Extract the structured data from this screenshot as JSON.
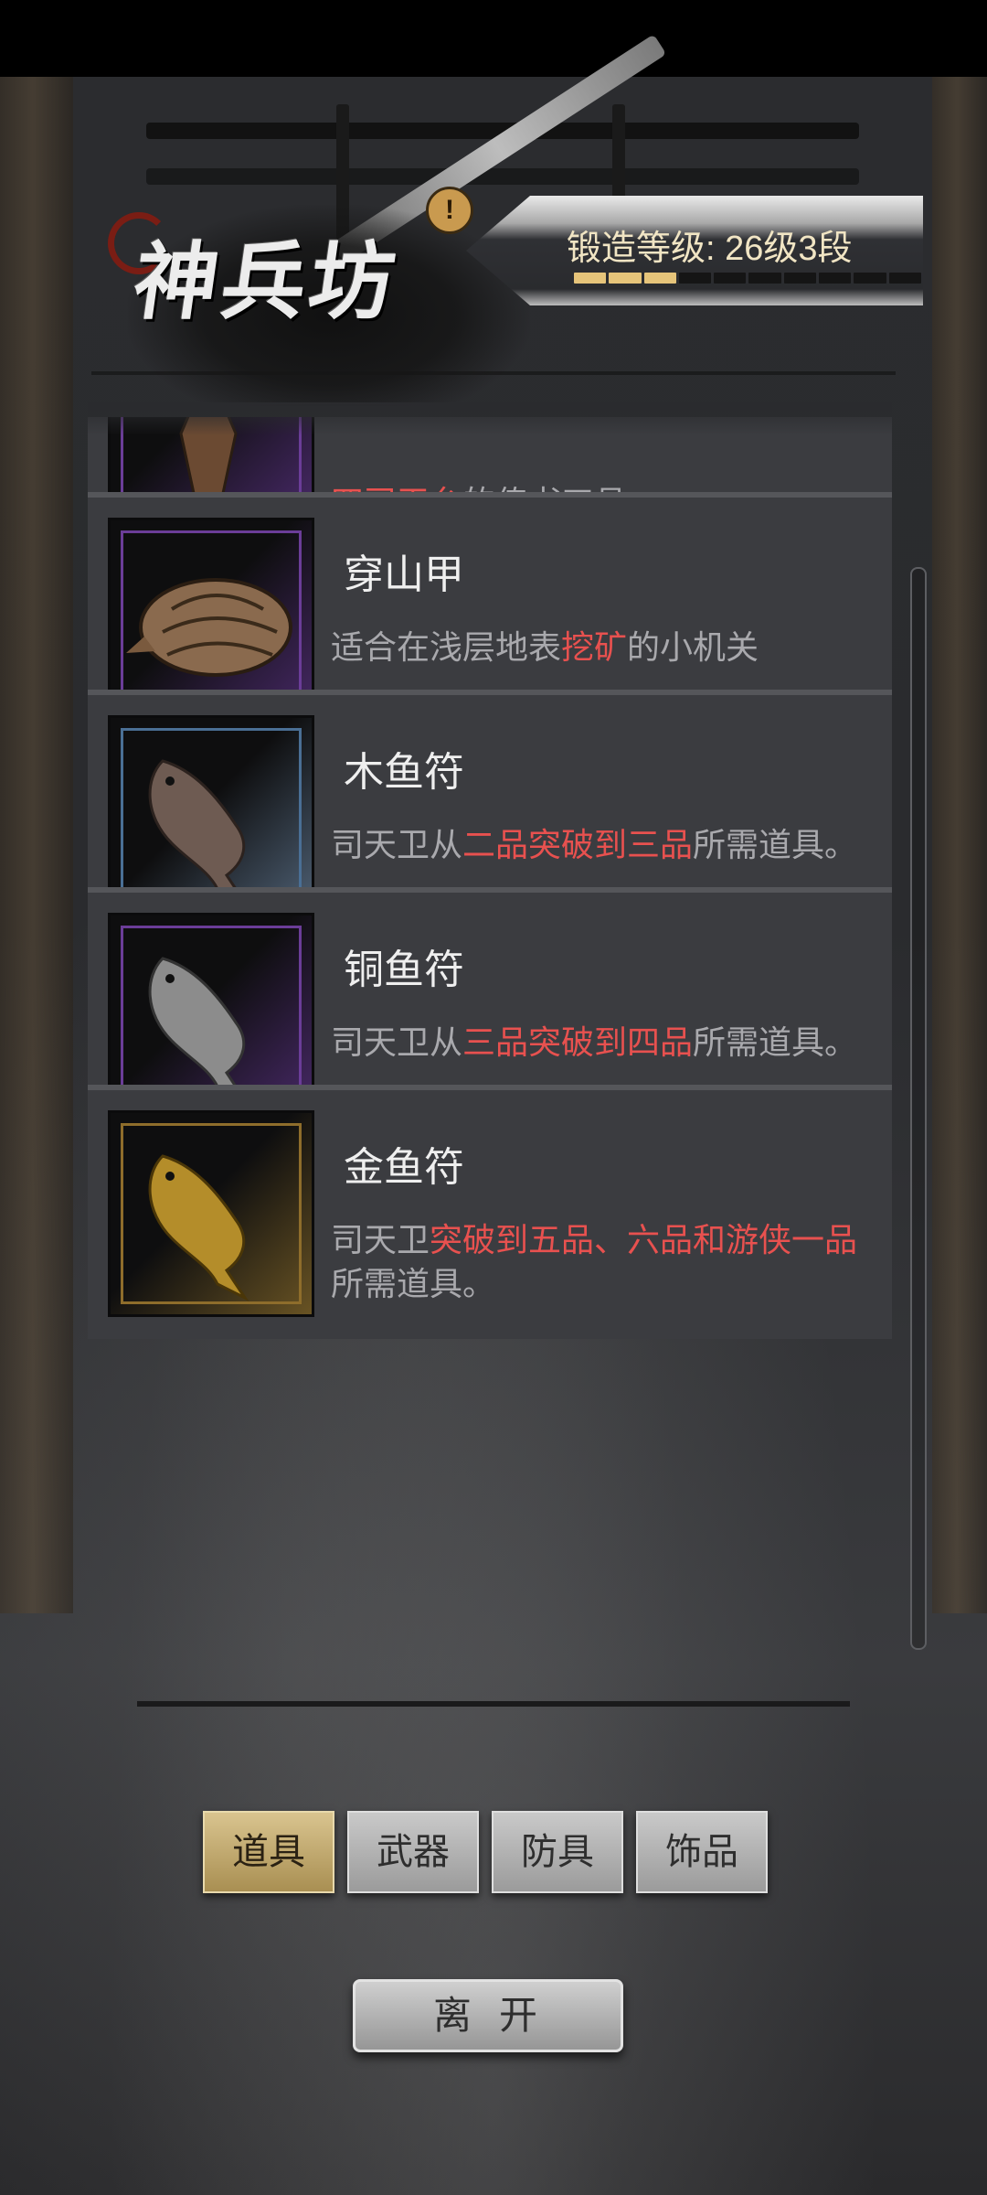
{
  "header": {
    "title": "神兵坊",
    "info_icon": "!",
    "forge_level_label": "锻造等级: 26级3段",
    "forge_progress_segments_filled": 3,
    "forge_progress_segments_total": 10,
    "accent_color": "#e6c47a"
  },
  "items": [
    {
      "name": "",
      "desc_parts": [
        {
          "text": "四司天台",
          "highlight": true
        },
        {
          "text": "的传书工具",
          "highlight": false
        }
      ],
      "frame": "purple",
      "icon": "bird-figure-icon"
    },
    {
      "name": "穿山甲",
      "desc_parts": [
        {
          "text": "适合在浅层地表",
          "highlight": false
        },
        {
          "text": "挖矿",
          "highlight": true
        },
        {
          "text": "的小机关",
          "highlight": false
        }
      ],
      "frame": "purple",
      "icon": "pangolin-icon"
    },
    {
      "name": "木鱼符",
      "desc_parts": [
        {
          "text": "司天卫从",
          "highlight": false
        },
        {
          "text": "二品突破到三品",
          "highlight": true
        },
        {
          "text": "所需道具。",
          "highlight": false
        }
      ],
      "frame": "blue",
      "icon": "wooden-fish-token-icon"
    },
    {
      "name": "铜鱼符",
      "desc_parts": [
        {
          "text": "司天卫从",
          "highlight": false
        },
        {
          "text": "三品突破到四品",
          "highlight": true
        },
        {
          "text": "所需道具。",
          "highlight": false
        }
      ],
      "frame": "purple",
      "icon": "copper-fish-token-icon"
    },
    {
      "name": "金鱼符",
      "desc_parts": [
        {
          "text": "司天卫",
          "highlight": false
        },
        {
          "text": "突破到五品、六品和游侠一品",
          "highlight": true
        },
        {
          "text": "所需道具。",
          "highlight": false
        }
      ],
      "frame": "gold",
      "icon": "gold-fish-token-icon"
    }
  ],
  "tabs": [
    {
      "label": "道具",
      "active": true
    },
    {
      "label": "武器",
      "active": false
    },
    {
      "label": "防具",
      "active": false
    },
    {
      "label": "饰品",
      "active": false
    }
  ],
  "leave_button": "离开",
  "colors": {
    "highlight": "#e8514f",
    "frame_purple": "#6b3d98",
    "frame_blue": "#4a6f95",
    "frame_gold": "#8e6d2b"
  }
}
